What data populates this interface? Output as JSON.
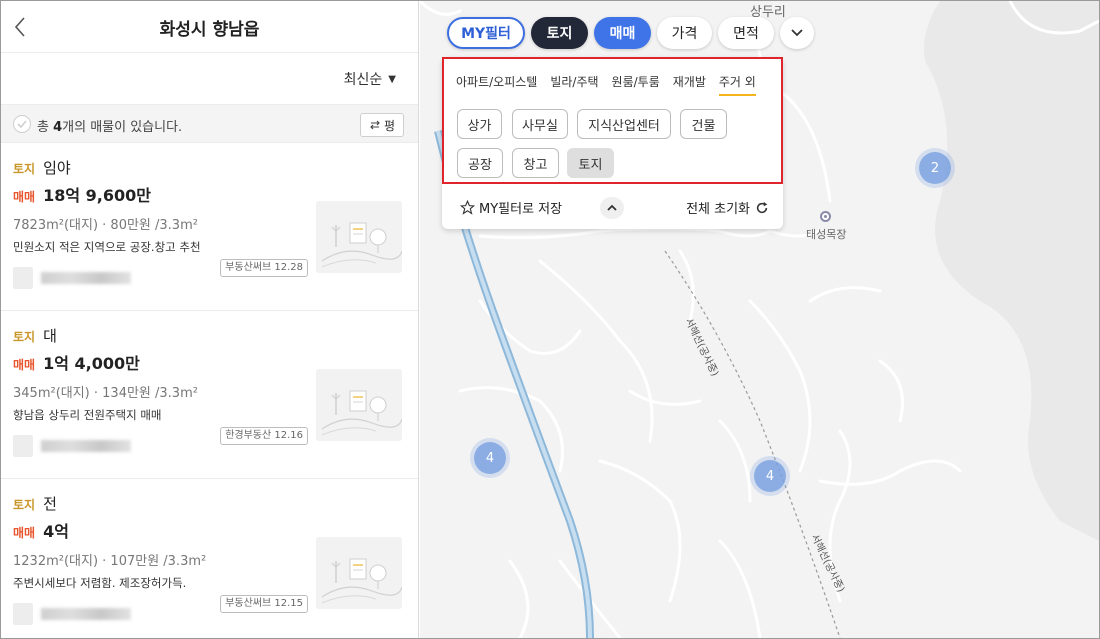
{
  "panel": {
    "title": "화성시 향남읍",
    "sort_label": "최신순",
    "count_prefix": "총 ",
    "count_value": "4",
    "count_suffix": "개의 매물이 있습니다.",
    "compare_label": "평"
  },
  "listings": [
    {
      "type_tag": "토지",
      "type_name": "임야",
      "deal_tag": "매매",
      "price": "18억 9,600만",
      "spec": "7823m²(대지) · 80만원 /3.3m²",
      "desc": "민원소지 적은 지역으로 공장.창고 추천",
      "source": "부동산써브 12.28"
    },
    {
      "type_tag": "토지",
      "type_name": "대",
      "deal_tag": "매매",
      "price": "1억 4,000만",
      "spec": "345m²(대지) · 134만원 /3.3m²",
      "desc": "향남읍 상두리 전원주택지 매매",
      "source": "한경부동산 12.16"
    },
    {
      "type_tag": "토지",
      "type_name": "전",
      "deal_tag": "매매",
      "price": "4억",
      "spec": "1232m²(대지) · 107만원 /3.3m²",
      "desc": "주변시세보다 저렴함. 제조장허가득.",
      "source": "부동산써브 12.15"
    }
  ],
  "map": {
    "place_sangduri": "상두리",
    "place_taeseong": "태성목장",
    "road_label": "서해선(공사중)",
    "clusters": [
      "2",
      "4",
      "4"
    ]
  },
  "filters": {
    "my_filter": "MY필터",
    "land": "토지",
    "sale": "매매",
    "price": "가격",
    "area": "면적"
  },
  "filter_panel": {
    "tabs": [
      "아파트/오피스텔",
      "빌라/주택",
      "원룸/투룸",
      "재개발",
      "주거 외"
    ],
    "types": [
      "상가",
      "사무실",
      "지식산업센터",
      "건물",
      "공장",
      "창고",
      "토지"
    ],
    "selected_type": "토지",
    "save_label": "MY필터로 저장",
    "reset_label": "전체 초기화"
  },
  "colors": {
    "primary_blue": "#3f74e8",
    "dark_chip": "#222838",
    "land_tag": "#c9962a",
    "deal_tag": "#e8552d",
    "highlight_red": "#e0242c",
    "active_tab_underline": "#f3b41e"
  }
}
